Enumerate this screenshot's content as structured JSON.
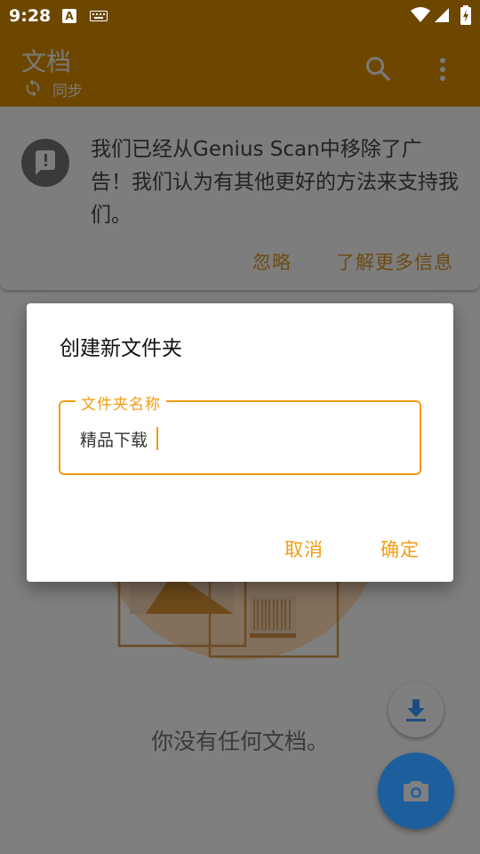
{
  "status_bar": {
    "time": "9:28",
    "indicator": "A"
  },
  "app_bar": {
    "title": "文档",
    "sync_label": "同步"
  },
  "notice": {
    "text": "我们已经从Genius Scan中移除了广告！我们认为有其他更好的方法来支持我们。",
    "ignore_label": "忽略",
    "learn_more_label": "了解更多信息"
  },
  "empty_state": {
    "text": "你没有任何文档。"
  },
  "dialog": {
    "title": "创建新文件夹",
    "field_label": "文件夹名称",
    "field_value": "精品下载",
    "cancel_label": "取消",
    "ok_label": "确定"
  },
  "colors": {
    "accent": "#f39c12",
    "app_bar_dimmed": "#6d4700",
    "camera_fab_dimmed": "#1d5e9c"
  }
}
